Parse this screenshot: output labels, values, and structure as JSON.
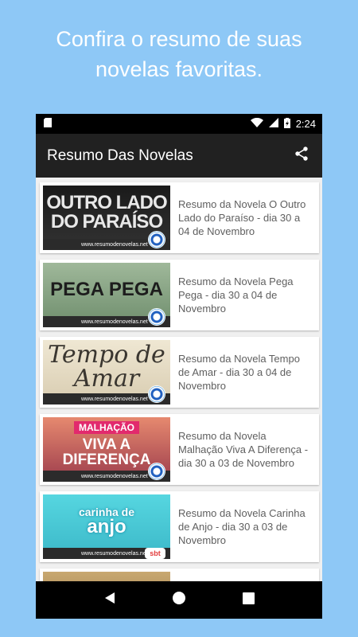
{
  "promo": {
    "line1": "Confira o resumo de suas",
    "line2": "novelas favoritas."
  },
  "status_bar": {
    "time": "2:24",
    "icons": [
      "sd-card-icon",
      "wifi-icon",
      "signal-icon",
      "battery-charging-icon"
    ]
  },
  "app_bar": {
    "title": "Resumo Das Novelas",
    "share_icon": "share-icon"
  },
  "thumb_footer": "www.resumodenovelas.net",
  "items": [
    {
      "art_title": "OUTRO LADO DO PARAÍSO",
      "network": "globo",
      "text": "Resumo da Novela O Outro Lado do Paraíso - dia 30 a 04 de Novembro"
    },
    {
      "art_title": "PEGA PEGA",
      "network": "globo",
      "text": "Resumo da Novela Pega Pega - dia 30 a 04 de Novembro"
    },
    {
      "art_title": "Tempo de Amar",
      "network": "globo",
      "text": "Resumo da Novela Tempo de Amar - dia 30 a 04 de Novembro"
    },
    {
      "art_small": "MALHAÇÃO",
      "art_title": "VIVA A DIFERENÇA",
      "network": "globo",
      "text": "Resumo da Novela Malhação Viva A Diferença - dia 30 a 03 de Novembro"
    },
    {
      "art_small": "carinha de",
      "art_title": "anjo",
      "network": "sbt",
      "text": "Resumo da Novela Carinha de Anjo - dia 30 a 03 de Novembro"
    }
  ],
  "colors": {
    "background": "#8ec8f6",
    "app_bar": "#212121",
    "text": "#5f5f5f"
  }
}
